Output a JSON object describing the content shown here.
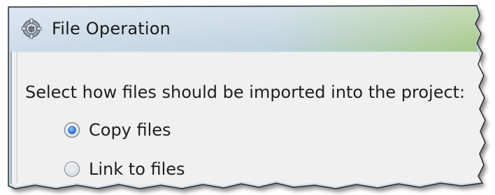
{
  "window": {
    "title": "File Operation",
    "icon": "gear-cube-icon"
  },
  "dialog": {
    "prompt": "Select how files should be imported into the project:",
    "options": [
      {
        "label": "Copy files",
        "selected": true
      },
      {
        "label": "Link to files",
        "selected": false
      }
    ]
  },
  "colors": {
    "titlebar_start": "#c9d9e8",
    "titlebar_end": "#a9c98f",
    "body_background": "#f0f0f0",
    "radio_dot": "#2a6fd6"
  }
}
